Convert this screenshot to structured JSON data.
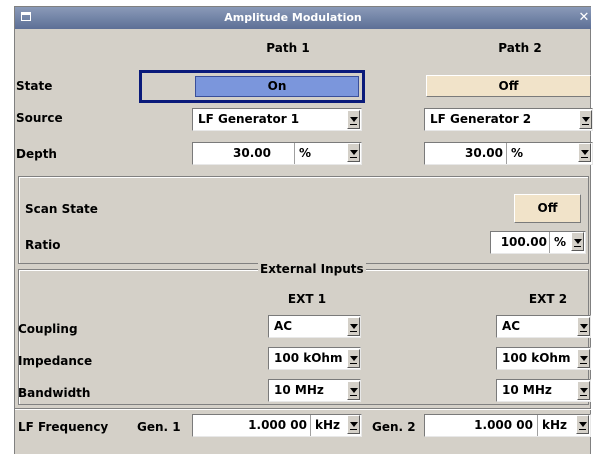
{
  "window": {
    "title": "Amplitude Modulation"
  },
  "paths": {
    "path1_header": "Path 1",
    "path2_header": "Path 2"
  },
  "rows": {
    "state": "State",
    "source": "Source",
    "depth": "Depth"
  },
  "path1": {
    "state": "On",
    "source": "LF Generator 1",
    "depth_value": "30.00",
    "depth_unit": "%"
  },
  "path2": {
    "state": "Off",
    "source": "LF Generator 2",
    "depth_value": "30.00",
    "depth_unit": "%"
  },
  "scan": {
    "state_label": "Scan State",
    "state_value": "Off",
    "ratio_label": "Ratio",
    "ratio_value": "100.00",
    "ratio_unit": "%"
  },
  "external": {
    "legend": "External Inputs",
    "ext1_header": "EXT 1",
    "ext2_header": "EXT 2",
    "coupling_label": "Coupling",
    "impedance_label": "Impedance",
    "bandwidth_label": "Bandwidth",
    "ext1": {
      "coupling": "AC",
      "impedance": "100 kOhm",
      "bandwidth": "10 MHz"
    },
    "ext2": {
      "coupling": "AC",
      "impedance": "100 kOhm",
      "bandwidth": "10 MHz"
    }
  },
  "lf": {
    "label": "LF Frequency",
    "gen1_label": "Gen. 1",
    "gen1_value": "1.000 00",
    "gen1_unit": "kHz",
    "gen2_label": "Gen. 2",
    "gen2_value": "1.000 00",
    "gen2_unit": "kHz"
  },
  "colors": {
    "on_button": "#7b96dc",
    "off_button": "#f1e3c9",
    "focus_border": "#0a1a7a",
    "panel": "#d4d0c8",
    "titlebar": "#5d6f96"
  }
}
